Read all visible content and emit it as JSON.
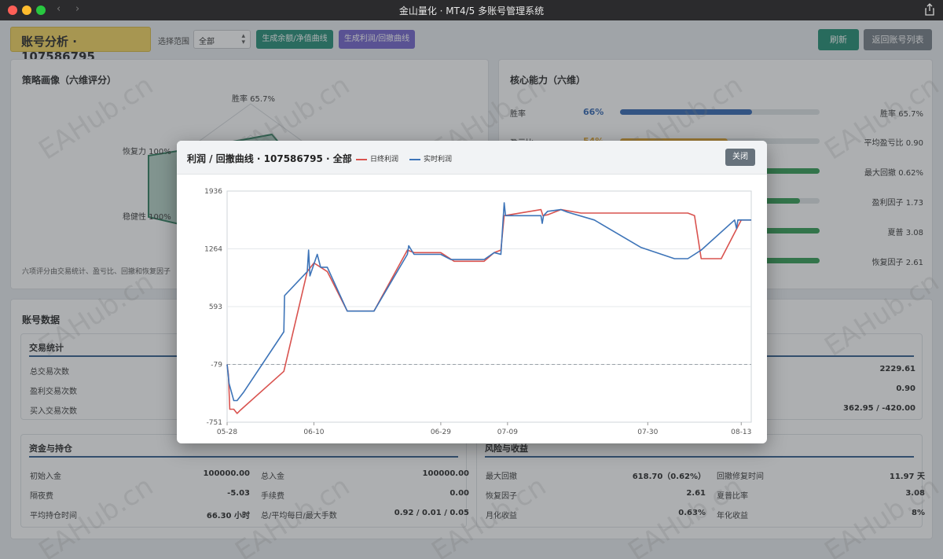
{
  "window": {
    "title": "金山量化 · MT4/5 多账号管理系统"
  },
  "header": {
    "page_title": "账号分析 · 107586795",
    "range_label": "选择范围",
    "range_value": "全部",
    "btn_equity": "生成余额/净值曲线",
    "btn_profit": "生成利润/回撤曲线",
    "btn_refresh": "刷新",
    "btn_back": "返回账号列表"
  },
  "strategy": {
    "title": "策略画像（六维评分）",
    "labels": {
      "win_rate": "胜率 65.7%",
      "recovery": "恢复力 100%",
      "stability": "稳健性 100%"
    },
    "note": "六项评分由交易统计、盈亏比、回撤和恢复因子"
  },
  "core": {
    "title": "核心能力（六维）",
    "rows": [
      {
        "name": "胜率",
        "value": "66%",
        "fill": 0.66,
        "color": "#2e63b0",
        "right": "胜率 65.7%"
      },
      {
        "name": "盈亏比",
        "value": "54%",
        "fill": 0.54,
        "color": "#e0a32b",
        "right": "平均盈亏比 0.90"
      },
      {
        "name": "",
        "value": "",
        "fill": 1.0,
        "color": "#2e9a50",
        "right": "最大回撤 0.62%"
      },
      {
        "name": "",
        "value": "",
        "fill": 0.9,
        "color": "#2e9a50",
        "right": "盈利因子 1.73"
      },
      {
        "name": "",
        "value": "",
        "fill": 1.0,
        "color": "#2e9a50",
        "right": "夏普 3.08"
      },
      {
        "name": "",
        "value": "",
        "fill": 1.0,
        "color": "#2e9a50",
        "right": "恢复因子 2.61"
      }
    ]
  },
  "account": {
    "title": "账号数据",
    "trade_stats": {
      "title": "交易统计",
      "rows": [
        {
          "k": "总交易次数",
          "v": ""
        },
        {
          "k": "盈利交易次数",
          "v": ""
        },
        {
          "k": "买入交易次数",
          "v": ""
        }
      ],
      "right_values": [
        "2229.61",
        "0.90",
        "362.95 / -420.00"
      ]
    },
    "funds": {
      "title": "资金与持仓",
      "rows": [
        {
          "k": "初始入金",
          "v": "100000.00",
          "k2": "总入金",
          "v2": "100000.00"
        },
        {
          "k": "隔夜费",
          "v": "-5.03",
          "k2": "手续费",
          "v2": "0.00"
        },
        {
          "k": "平均持仓时间",
          "v": "66.30 小时",
          "k2": "总/平均每日/最大手数",
          "v2": "0.92 / 0.01 / 0.05"
        }
      ]
    },
    "risk": {
      "title": "风险与收益",
      "rows": [
        {
          "k": "最大回撤",
          "v": "618.70（0.62%）",
          "k2": "回撤修复时间",
          "v2": "11.97 天"
        },
        {
          "k": "恢复因子",
          "v": "2.61",
          "k2": "夏普比率",
          "v2": "3.08"
        },
        {
          "k": "月化收益",
          "v": "0.63%",
          "k2": "年化收益",
          "v2": "8%"
        }
      ]
    }
  },
  "modal": {
    "title": "利润 / 回撤曲线 · 107586795 · 全部",
    "legend_daily": "日终利润",
    "legend_realtime": "实时利润",
    "close": "关闭"
  },
  "watermark": "EAHub.cn",
  "chart_data": {
    "type": "line",
    "ylim": [
      -751,
      1936
    ],
    "y_ticks": [
      1936,
      1264,
      593,
      -79,
      -751
    ],
    "x_ticks": [
      "05-28",
      "06-10",
      "06-29",
      "07-09",
      "07-30",
      "08-13"
    ],
    "x_tick_days": [
      0,
      13,
      32,
      42,
      63,
      77
    ],
    "baseline": -79,
    "series": [
      {
        "name": "日终利润",
        "color": "#d9534f",
        "points": [
          [
            0,
            -79
          ],
          [
            0.2,
            -200
          ],
          [
            0.4,
            -600
          ],
          [
            1,
            -600
          ],
          [
            1.5,
            -650
          ],
          [
            2,
            -610
          ],
          [
            8.5,
            -160
          ],
          [
            12,
            1000
          ],
          [
            13,
            1100
          ],
          [
            14,
            1050
          ],
          [
            15,
            1000
          ],
          [
            18,
            540
          ],
          [
            22,
            540
          ],
          [
            27,
            1250
          ],
          [
            28,
            1220
          ],
          [
            32,
            1220
          ],
          [
            34,
            1120
          ],
          [
            38.5,
            1120
          ],
          [
            40,
            1220
          ],
          [
            41,
            1250
          ],
          [
            41.5,
            1650
          ],
          [
            47,
            1720
          ],
          [
            47.3,
            1650
          ],
          [
            48,
            1660
          ],
          [
            50,
            1720
          ],
          [
            53,
            1680
          ],
          [
            69,
            1680
          ],
          [
            70,
            1650
          ],
          [
            71,
            1150
          ],
          [
            74,
            1150
          ],
          [
            77,
            1600
          ],
          [
            78.5,
            1600
          ]
        ]
      },
      {
        "name": "实时利润",
        "color": "#3d74b8",
        "points": [
          [
            0,
            -79
          ],
          [
            0.3,
            -300
          ],
          [
            1,
            -500
          ],
          [
            1.5,
            -500
          ],
          [
            2.5,
            -400
          ],
          [
            8.5,
            300
          ],
          [
            8.6,
            720
          ],
          [
            12,
            1000
          ],
          [
            12.2,
            1250
          ],
          [
            12.4,
            950
          ],
          [
            13.5,
            1200
          ],
          [
            14,
            1050
          ],
          [
            15,
            1050
          ],
          [
            18,
            540
          ],
          [
            22,
            540
          ],
          [
            27,
            1200
          ],
          [
            27.2,
            1300
          ],
          [
            28,
            1200
          ],
          [
            32,
            1200
          ],
          [
            33.5,
            1140
          ],
          [
            38.5,
            1140
          ],
          [
            40,
            1220
          ],
          [
            41,
            1200
          ],
          [
            41.5,
            1800
          ],
          [
            41.7,
            1650
          ],
          [
            47,
            1650
          ],
          [
            47.2,
            1560
          ],
          [
            47.4,
            1650
          ],
          [
            48,
            1700
          ],
          [
            50,
            1720
          ],
          [
            51,
            1690
          ],
          [
            55,
            1600
          ],
          [
            62,
            1280
          ],
          [
            67,
            1150
          ],
          [
            69,
            1150
          ],
          [
            71,
            1250
          ],
          [
            76,
            1600
          ],
          [
            76.3,
            1500
          ],
          [
            76.5,
            1600
          ],
          [
            78.5,
            1600
          ]
        ]
      }
    ]
  }
}
